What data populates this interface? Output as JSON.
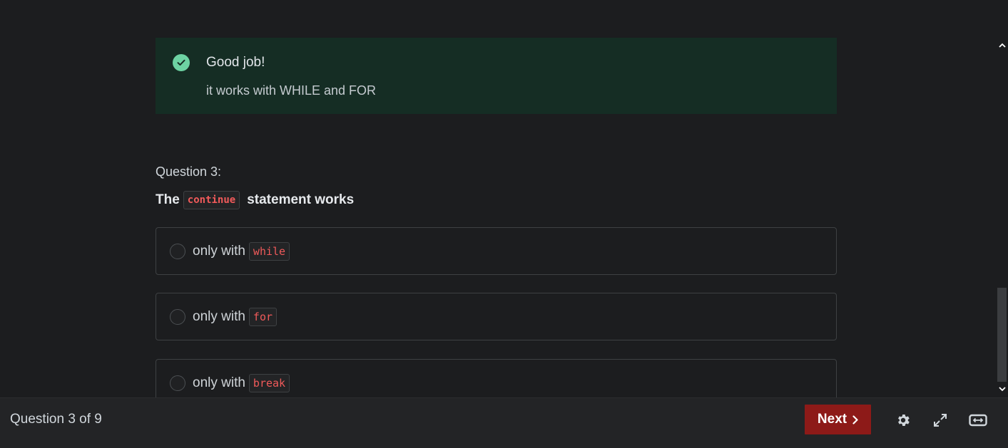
{
  "feedback": {
    "title": "Good job!",
    "message": "it works with WHILE and FOR",
    "icon": "check-circle-icon",
    "accent": "#6dd3a3"
  },
  "question": {
    "number_label": "Question 3:",
    "prompt_pre": "The",
    "prompt_code": "continue",
    "prompt_post": "statement works"
  },
  "options": [
    {
      "text": "only with",
      "code": "while"
    },
    {
      "text": "only with",
      "code": "for"
    },
    {
      "text": "only with",
      "code": "break"
    }
  ],
  "footer": {
    "progress": "Question 3 of 9",
    "next_label": "Next",
    "next_color": "#8d1a18",
    "icons": [
      "settings-icon",
      "expand-icon",
      "widescreen-icon"
    ]
  }
}
